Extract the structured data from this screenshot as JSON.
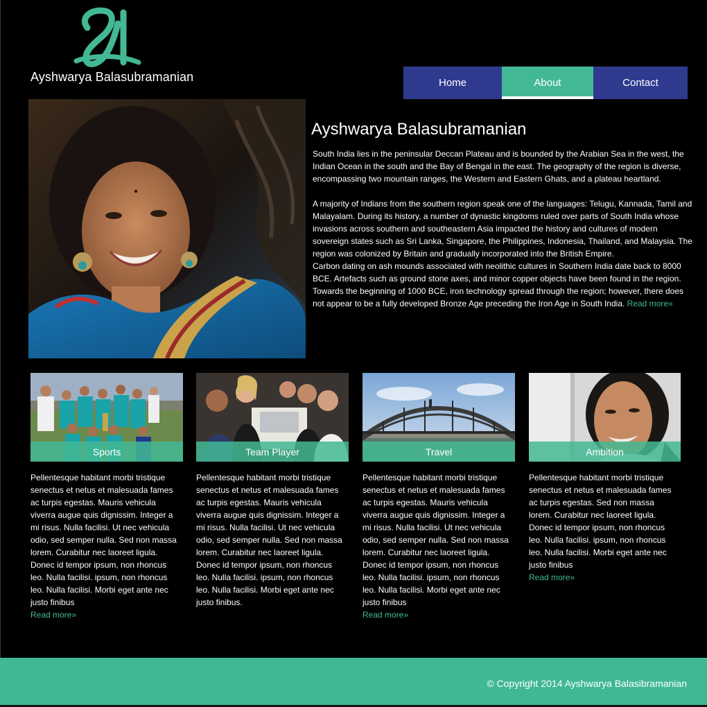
{
  "brand": {
    "monogram": "A",
    "name": "Ayshwarya Balasubramanian",
    "accent": "#43b894",
    "nav_color": "#2f3a8f"
  },
  "nav": {
    "home": "Home",
    "about": "About",
    "contact": "Contact",
    "active": "About"
  },
  "intro": {
    "title": "Ayshwarya Balasubramanian",
    "paragraph1": "South India lies in the peninsular Deccan Plateau and is bounded by the Arabian Sea in the west, the Indian Ocean in the south and the Bay of Bengal in the east. The geography of the region is diverse, encompassing two mountain ranges, the Western and Eastern Ghats, and a plateau heartland.",
    "paragraph2": "A majority of Indians from the southern region speak one of the languages: Telugu, Kannada, Tamil and Malayalam. During its history, a number of dynastic kingdoms ruled over parts of South India whose invasions across southern and southeastern Asia impacted the history and cultures of modern sovereign states such as Sri Lanka, Singapore, the Philippines, Indonesia, Thailand, and Malaysia. The region was colonized by Britain and gradually incorporated into the British Empire.",
    "paragraph3": "Carbon dating on ash mounds associated with neolithic cultures in Southern India date back to 8000 BCE. Artefacts such as ground stone axes, and minor copper objects have been found in the region. Towards the beginning of 1000 BCE, iron technology spread through the region; however, there does not appear to be a fully developed Bronze Age preceding the Iron Age in South India.",
    "read_more": "Read more»"
  },
  "cards": [
    {
      "caption": "Sports",
      "text": "Pellentesque habitant morbi tristique senectus et netus et malesuada fames ac turpis egestas. Mauris vehicula viverra augue quis dignissim. Integer a mi risus. Nulla facilisi. Ut nec vehicula odio, sed semper nulla. Sed non massa lorem. Curabitur nec laoreet ligula. Donec id tempor ipsum, non rhoncus leo. Nulla facilisi. ipsum, non rhoncus leo. Nulla facilisi. Morbi eget ante nec justo finibus",
      "read_more": "Read more»"
    },
    {
      "caption": "Team Player",
      "text": "Pellentesque habitant morbi tristique senectus et netus et malesuada fames ac turpis egestas. Mauris vehicula viverra augue quis dignissim. Integer a mi risus. Nulla facilisi. Ut nec vehicula odio, sed semper nulla. Sed non massa lorem. Curabitur nec laoreet ligula. Donec id tempor ipsum, non rhoncus leo. Nulla facilisi. ipsum, non rhoncus leo. Nulla facilisi. Morbi eget ante nec justo finibus.",
      "read_more": ""
    },
    {
      "caption": "Travel",
      "text": "Pellentesque habitant morbi tristique senectus et netus et malesuada fames ac turpis egestas. Mauris vehicula viverra augue quis dignissim. Integer a mi risus. Nulla facilisi. Ut nec vehicula odio, sed semper nulla. Sed non massa lorem. Curabitur nec laoreet ligula. Donec id tempor ipsum, non rhoncus leo. Nulla facilisi. ipsum, non rhoncus leo. Nulla facilisi. Morbi eget ante nec justo finibus",
      "read_more": "Read more»"
    },
    {
      "caption": "Ambition",
      "text": "Pellentesque habitant morbi tristique senectus et netus et malesuada fames ac turpis egestas. Sed non massa lorem. Curabitur nec laoreet ligula. Donec id tempor ipsum, non rhoncus leo. Nulla facilisi. ipsum, non rhoncus leo. Nulla facilisi. Morbi eget ante nec justo finibus",
      "read_more": "Read more»"
    }
  ],
  "footer": {
    "copyright": "© Copyright 2014  Ayshwarya Balasibramanian"
  }
}
